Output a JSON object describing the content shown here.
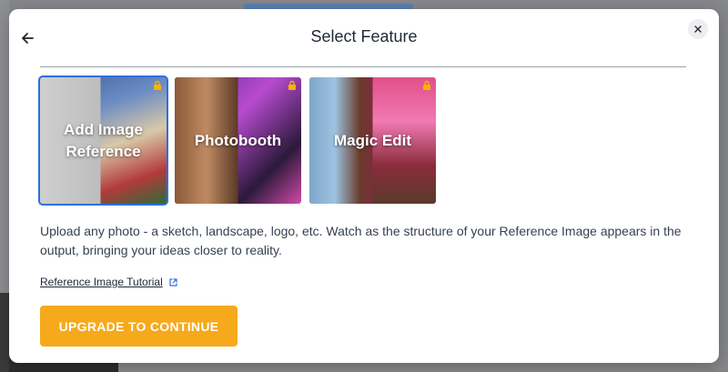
{
  "modal": {
    "title": "Select Feature",
    "description": "Upload any photo - a sketch, landscape, logo, etc. Watch as the structure of your Reference Image appears in the output, bringing your ideas closer to reality.",
    "tutorial_link": "Reference Image Tutorial",
    "upgrade_button": "UPGRADE TO CONTINUE",
    "icons": {
      "back": "arrow-left-icon",
      "close": "close-icon",
      "lock": "lock-icon",
      "external": "external-link-icon"
    },
    "colors": {
      "accent": "#f6a91b",
      "selected_outline": "#2f6fe0",
      "lock": "#f5b400"
    },
    "features": [
      {
        "label": "Add Image Reference",
        "selected": true
      },
      {
        "label": "Photobooth",
        "selected": false
      },
      {
        "label": "Magic Edit",
        "selected": false
      }
    ]
  }
}
